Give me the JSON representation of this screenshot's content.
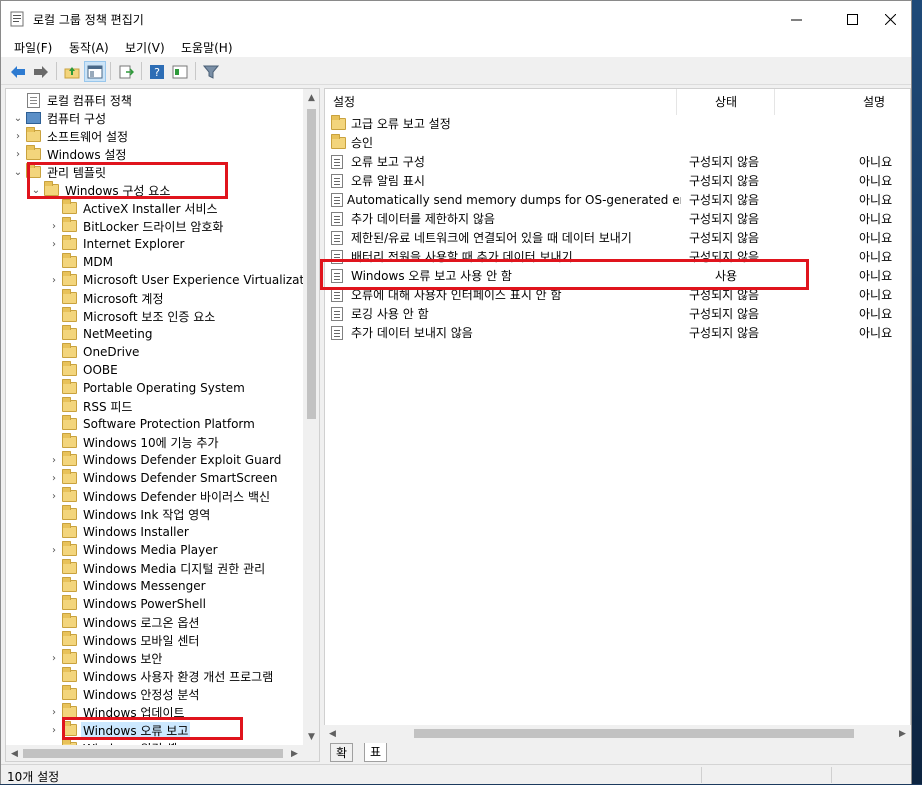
{
  "window": {
    "title": "로컬 그룹 정책 편집기"
  },
  "menu": [
    "파일(F)",
    "동작(A)",
    "보기(V)",
    "도움말(H)"
  ],
  "tree": [
    {
      "label": "로컬 컴퓨터 정책",
      "icon": "policy-icon",
      "depth": 0,
      "arrow": ""
    },
    {
      "label": "컴퓨터 구성",
      "icon": "computer-icon",
      "depth": 0,
      "arrow": "down"
    },
    {
      "label": "소프트웨어 설정",
      "icon": "folder-icon",
      "depth": 1,
      "arrow": "right"
    },
    {
      "label": "Windows 설정",
      "icon": "folder-icon",
      "depth": 1,
      "arrow": "right"
    },
    {
      "label": "관리 템플릿",
      "icon": "folder-icon",
      "depth": 1,
      "arrow": "down"
    },
    {
      "label": "Windows 구성 요소",
      "icon": "folder-icon",
      "depth": 2,
      "arrow": "down"
    },
    {
      "label": "ActiveX Installer 서비스",
      "icon": "folder-icon",
      "depth": 3,
      "arrow": ""
    },
    {
      "label": "BitLocker 드라이브 암호화",
      "icon": "folder-icon",
      "depth": 3,
      "arrow": "right"
    },
    {
      "label": "Internet Explorer",
      "icon": "folder-icon",
      "depth": 3,
      "arrow": "right"
    },
    {
      "label": "MDM",
      "icon": "folder-icon",
      "depth": 3,
      "arrow": ""
    },
    {
      "label": "Microsoft User Experience Virtualizat",
      "icon": "folder-icon",
      "depth": 3,
      "arrow": "right"
    },
    {
      "label": "Microsoft 계정",
      "icon": "folder-icon",
      "depth": 3,
      "arrow": ""
    },
    {
      "label": "Microsoft 보조 인증 요소",
      "icon": "folder-icon",
      "depth": 3,
      "arrow": ""
    },
    {
      "label": "NetMeeting",
      "icon": "folder-icon",
      "depth": 3,
      "arrow": ""
    },
    {
      "label": "OneDrive",
      "icon": "folder-icon",
      "depth": 3,
      "arrow": ""
    },
    {
      "label": "OOBE",
      "icon": "folder-icon",
      "depth": 3,
      "arrow": ""
    },
    {
      "label": "Portable Operating System",
      "icon": "folder-icon",
      "depth": 3,
      "arrow": ""
    },
    {
      "label": "RSS 피드",
      "icon": "folder-icon",
      "depth": 3,
      "arrow": ""
    },
    {
      "label": "Software Protection Platform",
      "icon": "folder-icon",
      "depth": 3,
      "arrow": ""
    },
    {
      "label": "Windows 10에 기능 추가",
      "icon": "folder-icon",
      "depth": 3,
      "arrow": ""
    },
    {
      "label": "Windows Defender Exploit Guard",
      "icon": "folder-icon",
      "depth": 3,
      "arrow": "right"
    },
    {
      "label": "Windows Defender SmartScreen",
      "icon": "folder-icon",
      "depth": 3,
      "arrow": "right"
    },
    {
      "label": "Windows Defender 바이러스 백신",
      "icon": "folder-icon",
      "depth": 3,
      "arrow": "right"
    },
    {
      "label": "Windows Ink 작업 영역",
      "icon": "folder-icon",
      "depth": 3,
      "arrow": ""
    },
    {
      "label": "Windows Installer",
      "icon": "folder-icon",
      "depth": 3,
      "arrow": ""
    },
    {
      "label": "Windows Media Player",
      "icon": "folder-icon",
      "depth": 3,
      "arrow": "right"
    },
    {
      "label": "Windows Media 디지털 권한 관리",
      "icon": "folder-icon",
      "depth": 3,
      "arrow": ""
    },
    {
      "label": "Windows Messenger",
      "icon": "folder-icon",
      "depth": 3,
      "arrow": ""
    },
    {
      "label": "Windows PowerShell",
      "icon": "folder-icon",
      "depth": 3,
      "arrow": ""
    },
    {
      "label": "Windows 로그온 옵션",
      "icon": "folder-icon",
      "depth": 3,
      "arrow": ""
    },
    {
      "label": "Windows 모바일 센터",
      "icon": "folder-icon",
      "depth": 3,
      "arrow": ""
    },
    {
      "label": "Windows 보안",
      "icon": "folder-icon",
      "depth": 3,
      "arrow": "right"
    },
    {
      "label": "Windows 사용자 환경 개선 프로그램",
      "icon": "folder-icon",
      "depth": 3,
      "arrow": ""
    },
    {
      "label": "Windows 안정성 분석",
      "icon": "folder-icon",
      "depth": 3,
      "arrow": ""
    },
    {
      "label": "Windows 업데이트",
      "icon": "folder-icon",
      "depth": 3,
      "arrow": "right"
    },
    {
      "label": "Windows 오류 보고",
      "icon": "folder-icon",
      "depth": 3,
      "arrow": "right",
      "selected": true
    },
    {
      "label": "Windows 원격 셸",
      "icon": "folder-icon",
      "depth": 3,
      "arrow": ""
    }
  ],
  "list": {
    "headers": {
      "setting": "설정",
      "state": "상태",
      "comment": "설명"
    },
    "rows": [
      {
        "icon": "folder-icon",
        "name": "고급 오류 보고 설정",
        "state": "",
        "comment": ""
      },
      {
        "icon": "folder-icon",
        "name": "승인",
        "state": "",
        "comment": ""
      },
      {
        "icon": "policy-setting-icon",
        "name": "오류 보고 구성",
        "state": "구성되지 않음",
        "comment": "아니요"
      },
      {
        "icon": "policy-setting-icon",
        "name": "오류 알림 표시",
        "state": "구성되지 않음",
        "comment": "아니요"
      },
      {
        "icon": "policy-setting-icon",
        "name": "Automatically send memory dumps for OS-generated erro...",
        "state": "구성되지 않음",
        "comment": "아니요"
      },
      {
        "icon": "policy-setting-icon",
        "name": "추가 데이터를 제한하지 않음",
        "state": "구성되지 않음",
        "comment": "아니요"
      },
      {
        "icon": "policy-setting-icon",
        "name": "제한된/유료 네트워크에 연결되어 있을 때 데이터 보내기",
        "state": "구성되지 않음",
        "comment": "아니요"
      },
      {
        "icon": "policy-setting-icon",
        "name": "배터리 전원을 사용할 때 추가 데이터 보내기",
        "state": "구성되지 않음",
        "comment": "아니요"
      },
      {
        "icon": "policy-setting-icon",
        "name": "Windows 오류 보고 사용 안 함",
        "state": "사용",
        "comment": "아니요"
      },
      {
        "icon": "policy-setting-icon",
        "name": "오류에 대해 사용자 인터페이스 표시 안 함",
        "state": "구성되지 않음",
        "comment": "아니요"
      },
      {
        "icon": "policy-setting-icon",
        "name": "로깅 사용 안 함",
        "state": "구성되지 않음",
        "comment": "아니요"
      },
      {
        "icon": "policy-setting-icon",
        "name": "추가 데이터 보내지 않음",
        "state": "구성되지 않음",
        "comment": "아니요"
      }
    ]
  },
  "tabs": [
    "확장",
    "표준"
  ],
  "status": {
    "text": "10개 설정"
  },
  "colors": {
    "highlight": "#e0141d",
    "selection": "#cce8ff",
    "folder": "#f3d57c"
  }
}
